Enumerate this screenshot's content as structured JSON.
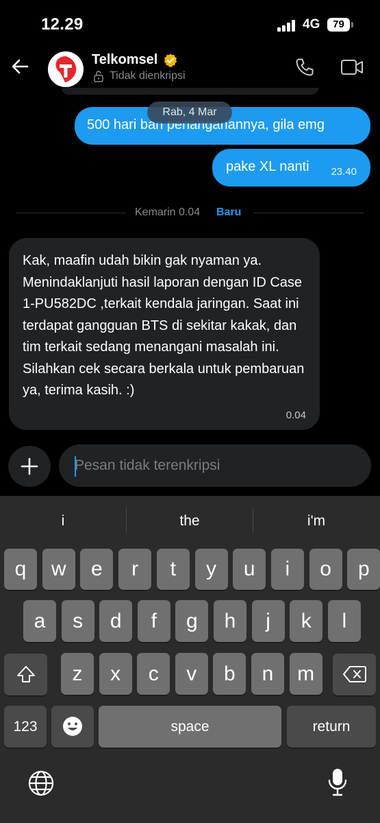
{
  "status": {
    "time": "12.29",
    "network": "4G",
    "battery": "79"
  },
  "header": {
    "name": "Telkomsel",
    "subtitle": "Tidak dienkripsi"
  },
  "messages": {
    "date_chip": "Rab, 4 Mar",
    "out1": "500 hari ban penanganannya, gila emg",
    "out2_text": "pake XL nanti",
    "out2_time": "23.40",
    "divider_text": "Kemarin 0.04",
    "divider_new": "Baru",
    "in1_text": "Kak, maafin udah bikin gak nyaman ya. Menindaklanjuti hasil laporan dengan ID Case 1-PU582DC ,terkait kendala jaringan. Saat ini terdapat gangguan BTS di sekitar kakak, dan tim terkait sedang menangani masalah ini. Silahkan cek secara berkala untuk pembaruan ya, terima kasih. :)",
    "in1_time": "0.04"
  },
  "composer": {
    "placeholder": "Pesan tidak terenkripsi"
  },
  "keyboard": {
    "suggestions": [
      "i",
      "the",
      "i'm"
    ],
    "row1": [
      "q",
      "w",
      "e",
      "r",
      "t",
      "y",
      "u",
      "i",
      "o",
      "p"
    ],
    "row2": [
      "a",
      "s",
      "d",
      "f",
      "g",
      "h",
      "j",
      "k",
      "l"
    ],
    "row3": [
      "z",
      "x",
      "c",
      "v",
      "b",
      "n",
      "m"
    ],
    "numbers": "123",
    "space": "space",
    "return": "return"
  },
  "colors": {
    "accent": "#1d9bf0",
    "bubble_in": "#1f2326",
    "verified": "#f4b400",
    "logo_red": "#e4262c"
  },
  "icons": [
    "back-arrow-icon",
    "verified-icon",
    "lock-icon",
    "phone-icon",
    "video-icon",
    "plus-icon",
    "shift-icon",
    "backspace-icon",
    "emoji-icon",
    "globe-icon",
    "mic-icon"
  ]
}
